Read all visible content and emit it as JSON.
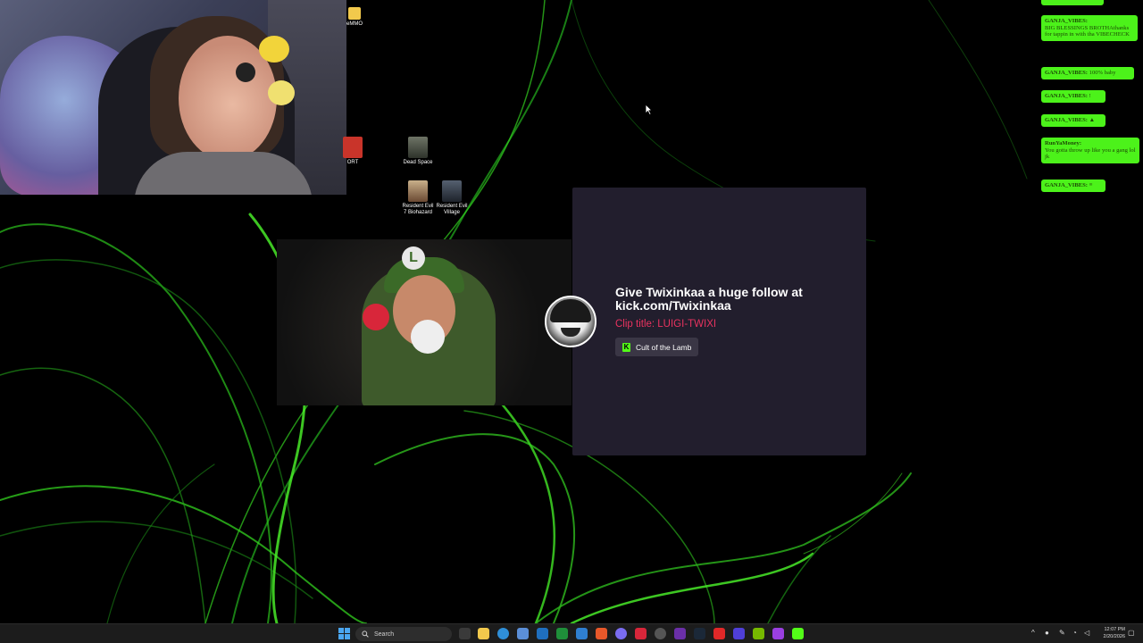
{
  "desktop": {
    "icons": [
      {
        "id": "emmo",
        "label": "eMMO"
      },
      {
        "id": "ort",
        "label": "ORT"
      },
      {
        "id": "dead-space",
        "label": "Dead Space"
      },
      {
        "id": "re7",
        "label": "Resident Evil 7 Biohazard"
      },
      {
        "id": "re-village",
        "label": "Resident Evil Village"
      }
    ]
  },
  "clip": {
    "follow_text": "Give Twixinkaa a huge follow at kick.com/Twixinkaa",
    "clip_title": "Clip title: LUIGI-TWIXI",
    "game": "Cult of the Lamb",
    "title_color": "#e8335f",
    "kick_color": "#53fc18"
  },
  "chat": {
    "messages": [
      {
        "user": "GANJA_VIBES:",
        "text": "BIG BLESSINGS BROTHAthanks for tappin in with tha VIBECHECK"
      },
      {
        "user": "GANJA_VIBES:",
        "text": "100% baby"
      },
      {
        "user": "GANJA_VIBES:",
        "text": "!"
      },
      {
        "user": "GANJA_VIBES:",
        "text": "▲"
      },
      {
        "user": "RunYaMoney:",
        "text": "You gotta throw up like you a gang lol jk"
      },
      {
        "user": "GANJA_VIBES:",
        "text": "≡"
      }
    ],
    "bubble_color": "#4cf21a"
  },
  "taskbar": {
    "search_placeholder": "Search",
    "time": "12:07 PM",
    "date": "2/20/2026"
  }
}
